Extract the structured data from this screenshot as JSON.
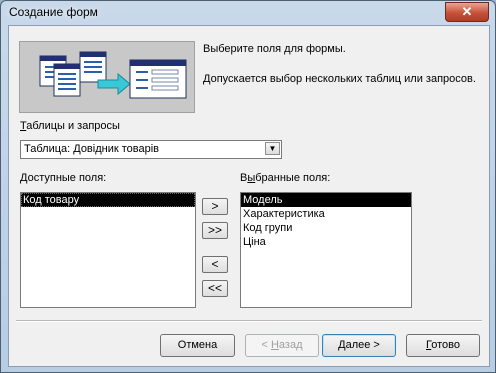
{
  "window": {
    "title": "Создание форм",
    "close_glyph": "✕"
  },
  "header": {
    "line1": "Выберите поля для формы.",
    "line2": "Допускается выбор нескольких таблиц или запросов.",
    "illustration_icon": "form-wizard-illustration"
  },
  "source": {
    "label_pre": "",
    "label_mn": "Т",
    "label_post": "аблицы и запросы",
    "value": "Таблица: Довідник товарів",
    "dropdown_glyph": "▼"
  },
  "available": {
    "label_pre": "",
    "label_mn": "Д",
    "label_post": "оступные поля:",
    "items": [
      "Код товару"
    ]
  },
  "selected": {
    "label_pre": "В",
    "label_mn": "ы",
    "label_post": "бранные поля:",
    "items": [
      "Модель",
      "Характеристика",
      "Код групи",
      "Ціна"
    ]
  },
  "move_buttons": {
    "add": ">",
    "add_all": ">>",
    "remove": "<",
    "remove_all": "<<"
  },
  "footer": {
    "cancel": "Отмена",
    "back_pre": "< ",
    "back_mn": "Н",
    "back_post": "азад",
    "next_pre": "",
    "next_mn": "Д",
    "next_post": "алее >",
    "finish_pre": "",
    "finish_mn": "Г",
    "finish_post": "отово"
  },
  "colors": {
    "title_gradient_top": "#c9d9ea",
    "selection": "#000000",
    "dialog_bg": "#f0f0f0"
  }
}
